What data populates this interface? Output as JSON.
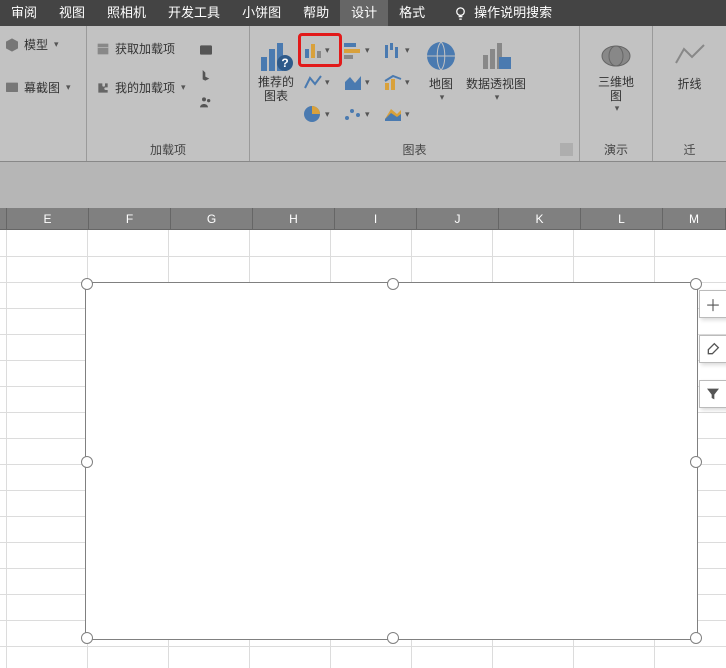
{
  "menu": {
    "items": [
      "审阅",
      "视图",
      "照相机",
      "开发工具",
      "小饼图",
      "帮助",
      "设计",
      "格式"
    ],
    "active_idx": 6,
    "search": "操作说明搜索"
  },
  "ribbon": {
    "g0": {
      "label": "",
      "model": "模型",
      "screenshot": "幕截图"
    },
    "addins": {
      "label": "加载项",
      "get": "获取加载项",
      "my": "我的加载项"
    },
    "charts": {
      "label": "图表",
      "recommend": "推荐的\n图表",
      "map": "地图",
      "pivot": "数据透视图",
      "map3d": "三维地\n图",
      "line": "折线"
    },
    "demo": {
      "label": "演示"
    },
    "tour": {
      "label": "迁"
    }
  },
  "columns": [
    "E",
    "F",
    "G",
    "H",
    "I",
    "J",
    "K",
    "L",
    "M"
  ]
}
